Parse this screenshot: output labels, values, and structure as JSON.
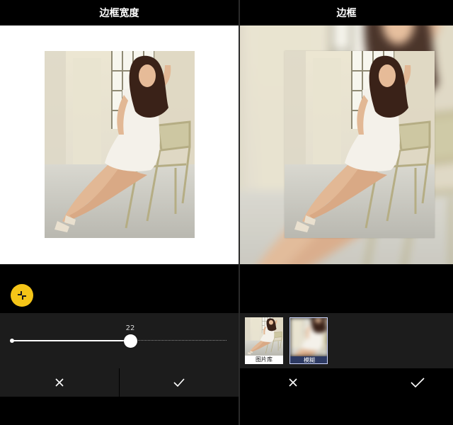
{
  "left_panel": {
    "title": "边框宽度",
    "slider": {
      "value": "22",
      "fraction": 0.55
    },
    "actions": {
      "cancel_icon": "close-icon",
      "confirm_icon": "check-icon"
    },
    "tool_icon": "shrink-icon"
  },
  "right_panel": {
    "title": "边框",
    "options": [
      {
        "label": "图片库",
        "selected": false
      },
      {
        "label": "模糊",
        "selected": true
      }
    ],
    "actions": {
      "cancel_icon": "close-icon",
      "confirm_icon": "check-icon"
    }
  },
  "colors": {
    "accent_yellow": "#f5c518",
    "panel_bg": "#1c1c1c",
    "selected_label": "#2d3a63"
  }
}
